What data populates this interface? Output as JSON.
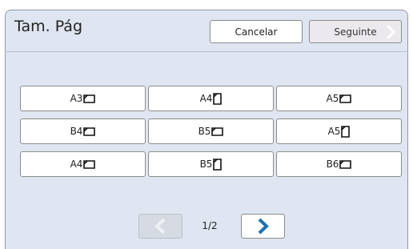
{
  "header": {
    "title": "Tam. Pág",
    "cancel_label": "Cancelar",
    "next_label": "Seguinte"
  },
  "sizes": [
    {
      "label": "A3",
      "orientation": "landscape"
    },
    {
      "label": "A4",
      "orientation": "portrait"
    },
    {
      "label": "A5",
      "orientation": "landscape"
    },
    {
      "label": "B4",
      "orientation": "landscape"
    },
    {
      "label": "B5",
      "orientation": "landscape"
    },
    {
      "label": "A5",
      "orientation": "portrait"
    },
    {
      "label": "A4",
      "orientation": "landscape"
    },
    {
      "label": "B5",
      "orientation": "portrait"
    },
    {
      "label": "B6",
      "orientation": "landscape"
    }
  ],
  "pagination": {
    "indicator": "1/2"
  },
  "colors": {
    "panel": "#dfe6f1",
    "next_arrow_active": "#1f6fb3",
    "arrow_disabled": "#eef1f5"
  }
}
